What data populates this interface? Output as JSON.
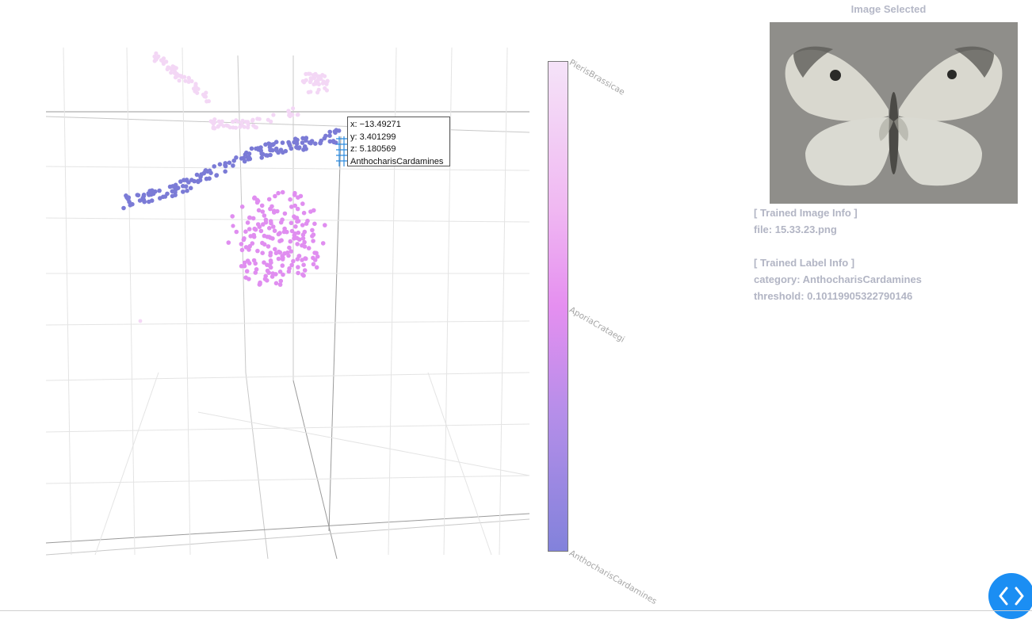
{
  "tooltip": {
    "x_line": "x: −13.49271",
    "y_line": "y: 3.401299",
    "z_line": "z: 5.180569",
    "label_line": "AnthocharisCardamines"
  },
  "colorbar": {
    "top_label": "PierisBrassicae",
    "mid_label": "AporiaCrataegi",
    "bottom_label": "AnthocharisCardamines",
    "colors": [
      "#f5e3f8",
      "#f0b8f2",
      "#e58ff0",
      "#b58ee9",
      "#8282db"
    ]
  },
  "panel": {
    "title": "Image Selected",
    "image_info_header": "[ Trained Image Info ]",
    "file_line": "file: 15.33.23.png",
    "label_info_header": "[ Trained Label Info ]",
    "category_line": "category: AnthocharisCardamines",
    "threshold_line": "threshold: 0.10119905322790146"
  },
  "chart_data": {
    "type": "scatter",
    "dimensions": 3,
    "categories": [
      "AnthocharisCardamines",
      "AporiaCrataegi",
      "PierisBrassicae"
    ],
    "category_colors": {
      "AnthocharisCardamines": "#7b7bd6",
      "AporiaCrataegi": "#e08ef0",
      "PierisBrassicae": "#f3d7f5"
    },
    "hovered_point": {
      "x": -13.49271,
      "y": 3.401299,
      "z": 5.180569,
      "category": "AnthocharisCardamines"
    }
  },
  "icons": {
    "toggle": "chevron-left-right-icon"
  }
}
